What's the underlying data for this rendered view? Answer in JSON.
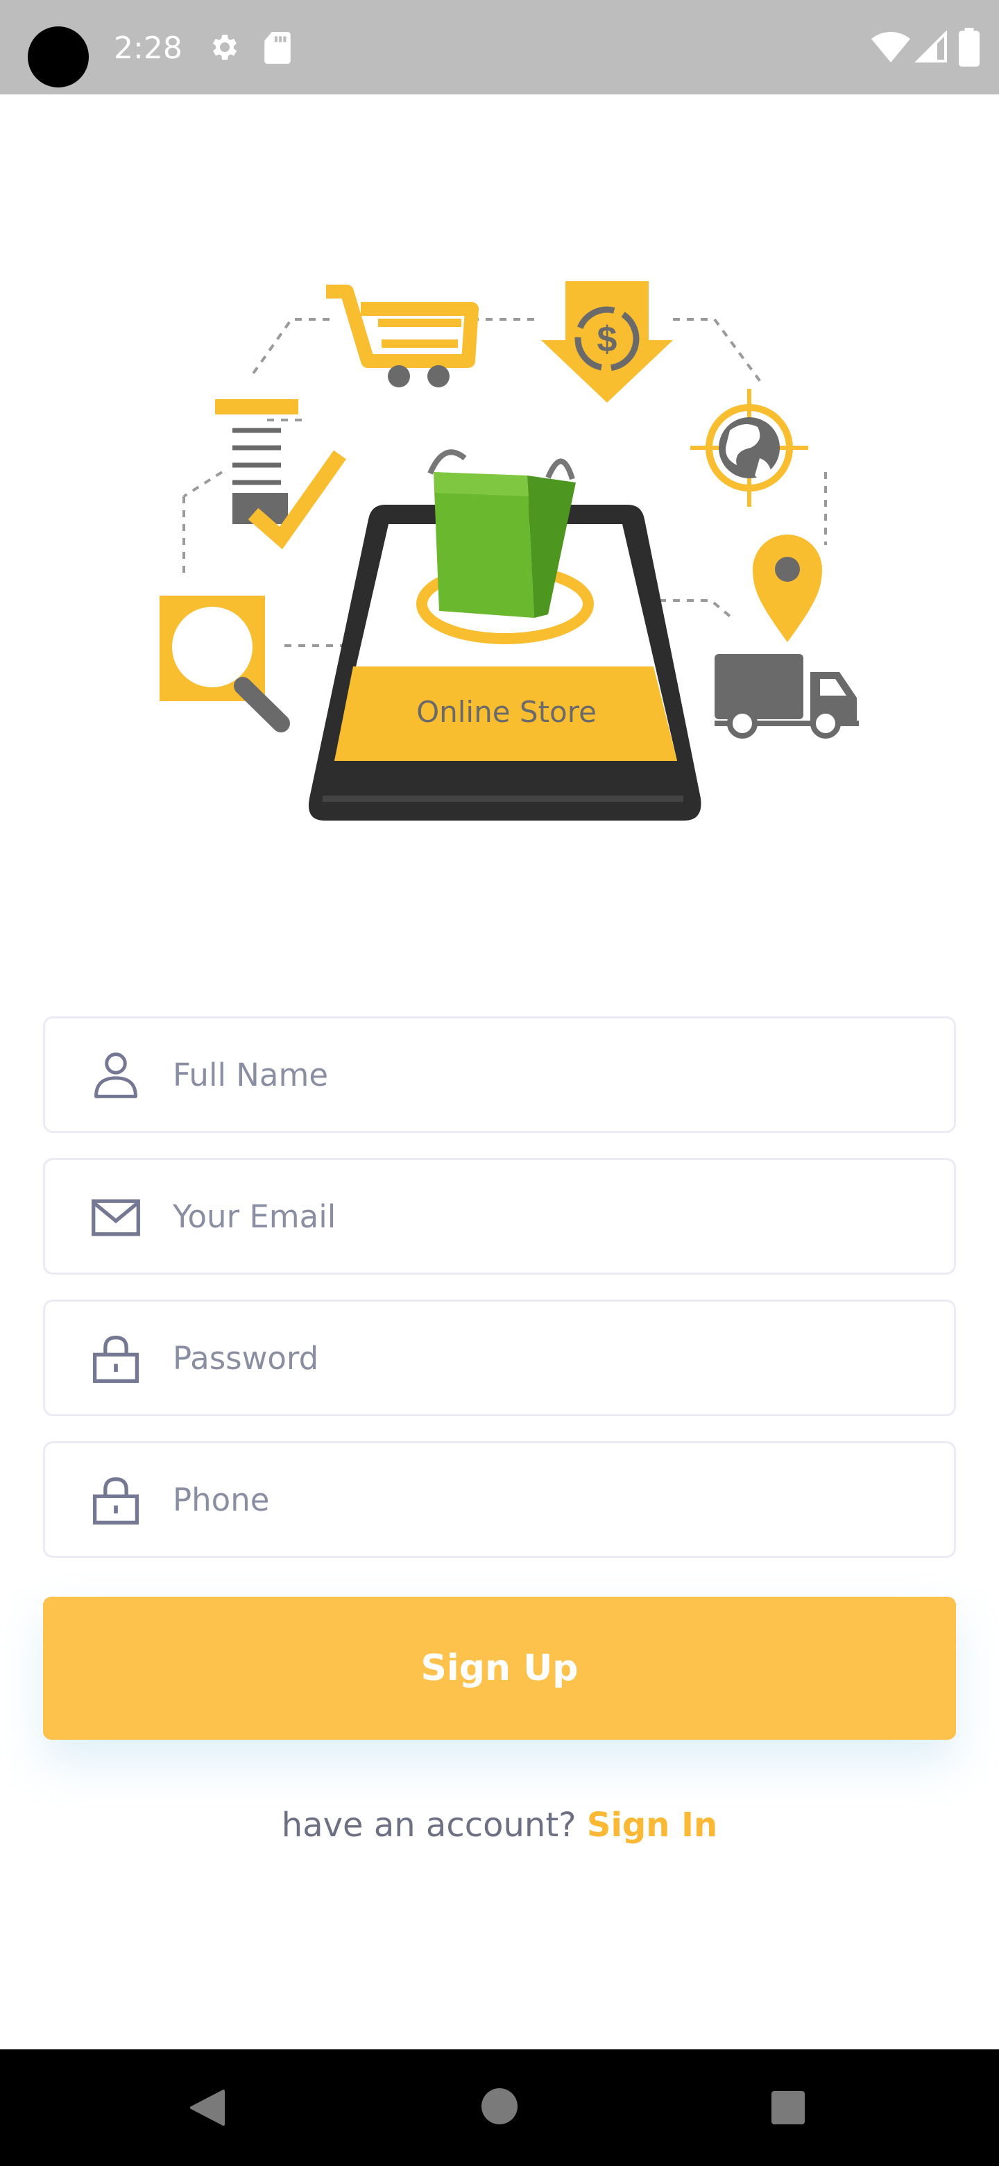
{
  "status_bar": {
    "time": "2:28"
  },
  "illustration": {
    "screen_label": "Online Store",
    "icons": [
      "shopping-cart-icon",
      "dollar-download-icon",
      "globe-target-icon",
      "document-check-icon",
      "magnifier-icon",
      "location-pin-icon",
      "delivery-truck-icon",
      "shopping-bag-icon",
      "smartphone-icon"
    ]
  },
  "form": {
    "full_name": {
      "placeholder": "Full Name",
      "value": ""
    },
    "email": {
      "placeholder": "Your Email",
      "value": ""
    },
    "password": {
      "placeholder": "Password",
      "value": ""
    },
    "phone": {
      "placeholder": "Phone",
      "value": ""
    }
  },
  "actions": {
    "signup_label": "Sign Up",
    "signin_prompt": "have an account?",
    "signin_link": "Sign In"
  },
  "colors": {
    "accent": "#fcc24c",
    "link": "#fbb835",
    "icon": "#747892",
    "field_border": "#ebeaf5",
    "placeholder": "#8a8ea3"
  }
}
